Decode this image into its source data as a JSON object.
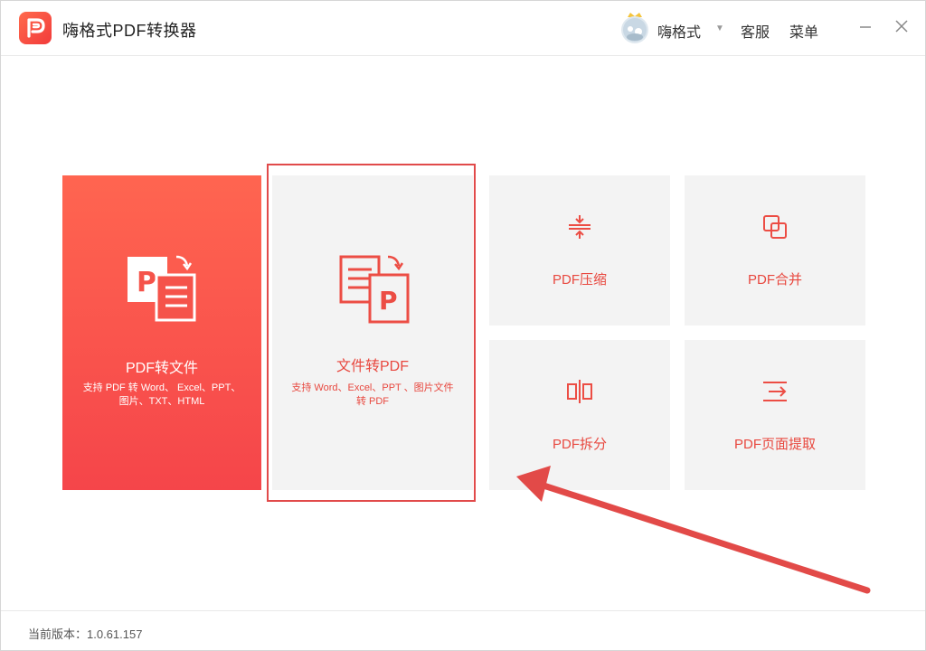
{
  "app": {
    "title": "嗨格式PDF转换器",
    "brand_color": "#f2473f"
  },
  "header": {
    "user_name": "嗨格式",
    "service_label": "客服",
    "menu_label": "菜单",
    "minimize_icon": "minimize-icon",
    "close_icon": "close-icon"
  },
  "cards": {
    "pdf_to_file": {
      "title": "PDF转文件",
      "desc": "支持 PDF 转 Word、 Excel、PPT、图片、TXT、HTML",
      "icon": "pdf-to-doc-icon"
    },
    "file_to_pdf": {
      "title": "文件转PDF",
      "desc": "支持 Word、Excel、PPT 、图片文件转 PDF",
      "icon": "doc-to-pdf-icon"
    },
    "compress": {
      "label": "PDF压缩",
      "icon": "compress-icon"
    },
    "merge": {
      "label": "PDF合并",
      "icon": "merge-icon"
    },
    "split": {
      "label": "PDF拆分",
      "icon": "split-icon"
    },
    "extract": {
      "label": "PDF页面提取",
      "icon": "extract-icon"
    }
  },
  "footer": {
    "version_text": "当前版本：1.0.61.157"
  }
}
